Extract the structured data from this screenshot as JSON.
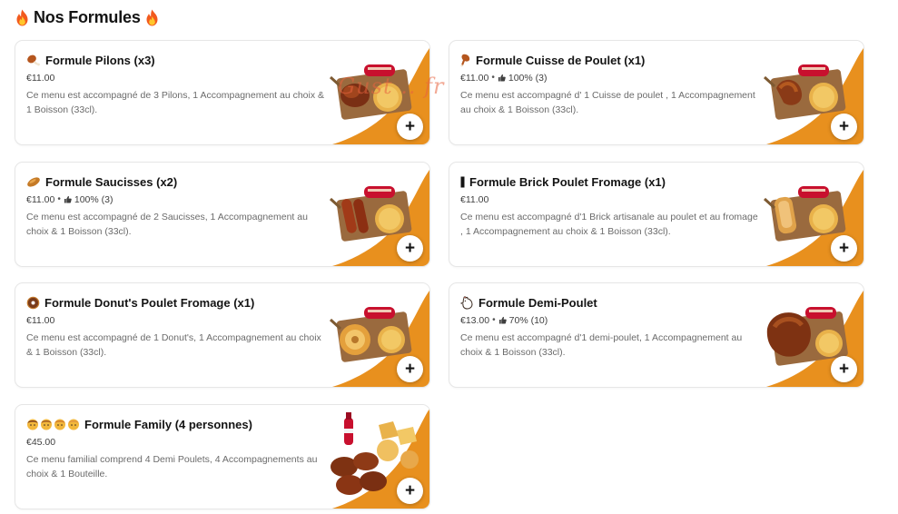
{
  "section": {
    "title": "Nos Formules",
    "icon": "fire-icon"
  },
  "watermark": {
    "text": "Gust .. fr"
  },
  "items": [
    {
      "title": "Formule Pilons (x3)",
      "price": "€11.00",
      "rating": "",
      "description": "Ce menu est accompagné de 3 Pilons, 1 Accompagnement au choix & 1 Boisson (33cl).",
      "emoji": [
        "drumstick-icon"
      ],
      "add_label": "+"
    },
    {
      "title": "Formule Cuisse de Poulet (x1)",
      "price": "€11.00",
      "rating": "100% (3)",
      "description": "Ce menu est accompagné d' 1 Cuisse de poulet , 1 Accompagnement au choix & 1 Boisson (33cl).",
      "emoji": [
        "chicken-leg-icon"
      ],
      "add_label": "+"
    },
    {
      "title": "Formule Saucisses (x2)",
      "price": "€11.00",
      "rating": "100% (3)",
      "description": "Ce menu est accompagné de 2 Saucisses, 1 Accompagnement au choix & 1 Boisson (33cl).",
      "emoji": [
        "sausage-icon"
      ],
      "add_label": "+"
    },
    {
      "title": "Formule Brick Poulet Fromage (x1)",
      "price": "€11.00",
      "rating": "",
      "description": "Ce menu est accompagné d'1 Brick artisanale au poulet et au fromage , 1 Accompagnement au choix & 1 Boisson (33cl).",
      "emoji": [
        "brick-icon"
      ],
      "add_label": "+"
    },
    {
      "title": "Formule Donut's Poulet Fromage (x1)",
      "price": "€11.00",
      "rating": "",
      "description": "Ce menu est accompagné de 1 Donut's, 1 Accompagnement au choix & 1 Boisson (33cl).",
      "emoji": [
        "donut-icon"
      ],
      "add_label": "+"
    },
    {
      "title": "Formule Demi-Poulet",
      "price": "€13.00",
      "rating": "70% (10)",
      "description": "Ce menu est accompagné d'1 demi-poulet, 1 Accompagnement au choix & 1 Boisson (33cl).",
      "emoji": [
        "rooster-icon"
      ],
      "add_label": "+"
    },
    {
      "title": "Formule Family (4 personnes)",
      "price": "€45.00",
      "rating": "",
      "description": "Ce menu familial comprend 4 Demi Poulets, 4 Accompagnements au choix & 1 Bouteille.",
      "emoji": [
        "face-icon",
        "face-icon",
        "face-icon",
        "face-icon"
      ],
      "add_label": "+"
    }
  ],
  "colors": {
    "accent_orange": "#e8901e",
    "board_brown": "#9a6a3e",
    "soda_red": "#c8102e"
  }
}
